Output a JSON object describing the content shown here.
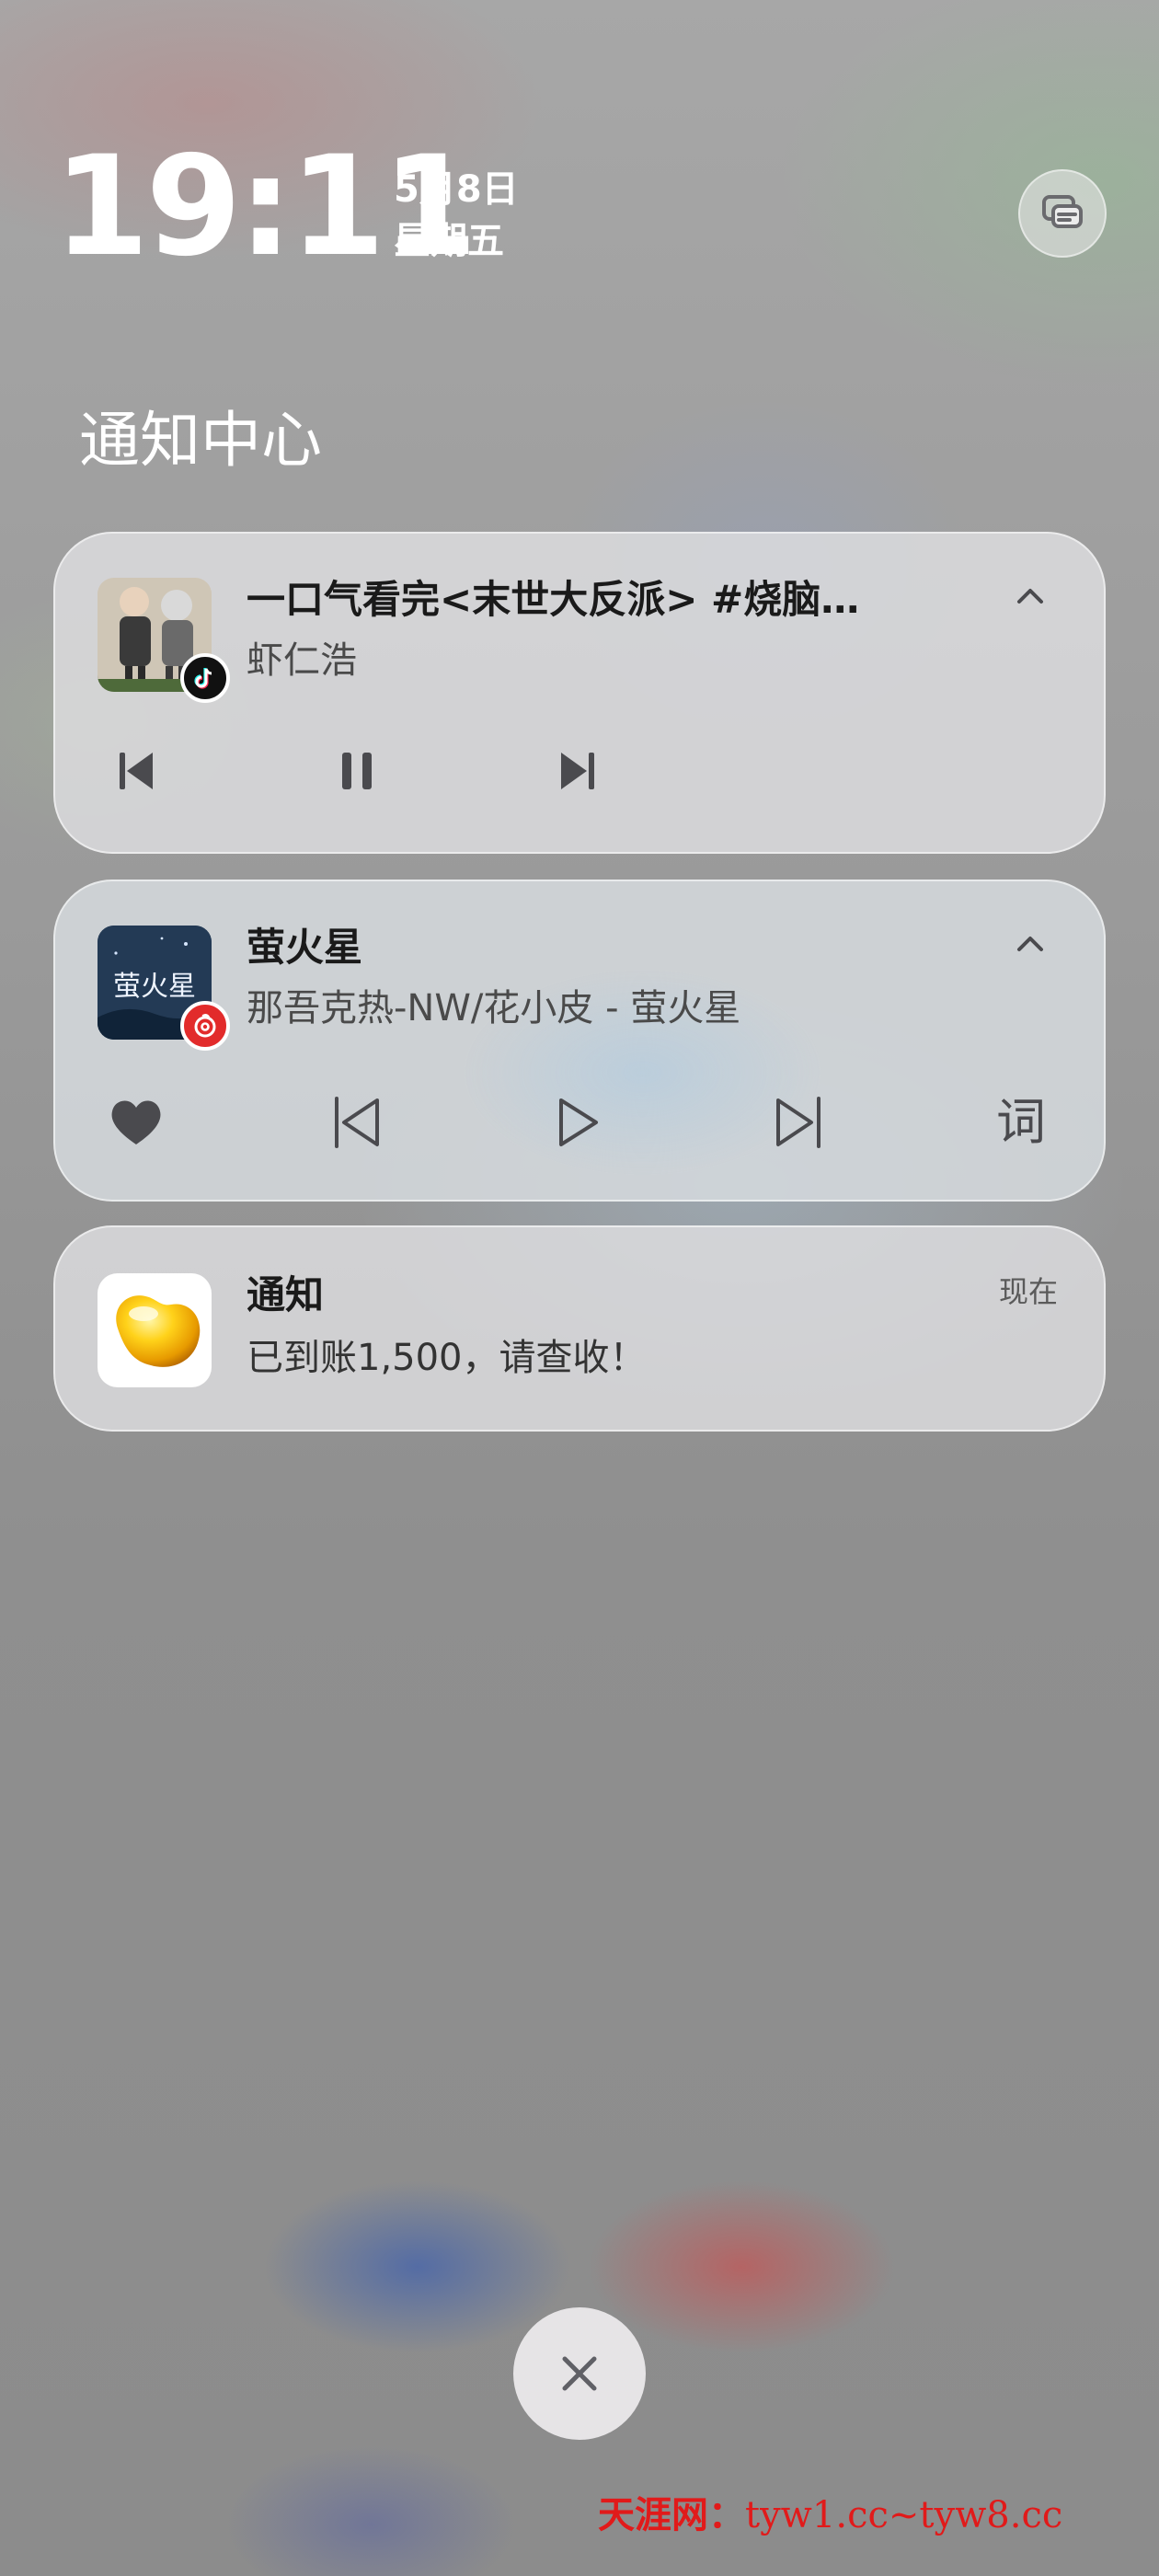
{
  "status": {
    "time": "19:11",
    "date": "5月8日",
    "weekday": "星期五"
  },
  "header": {
    "title": "通知中心"
  },
  "media1": {
    "title": "一口气看完<末世大反派> #烧脑…",
    "subtitle": "虾仁浩",
    "app_icon": "tiktok-icon"
  },
  "media2": {
    "title": "萤火星",
    "subtitle": "那吾克热-NW/花小皮 - 萤火星",
    "art_text": "萤火星",
    "lyrics_label": "词",
    "app_icon": "netease-music-icon"
  },
  "notification": {
    "title": "通知",
    "body": "已到账1,500，请查收！",
    "time": "现在",
    "app_icon": "golden-bean-icon"
  },
  "watermark": {
    "brand": "天涯网：",
    "urls": "tyw1.cc~tyw8.cc"
  },
  "colors": {
    "card_bg": "#dedee0",
    "text_primary": "#1a1a1a",
    "text_secondary": "#4a4a4a",
    "icon_dark": "#4a4a4e",
    "watermark_red": "#e11a1a"
  }
}
